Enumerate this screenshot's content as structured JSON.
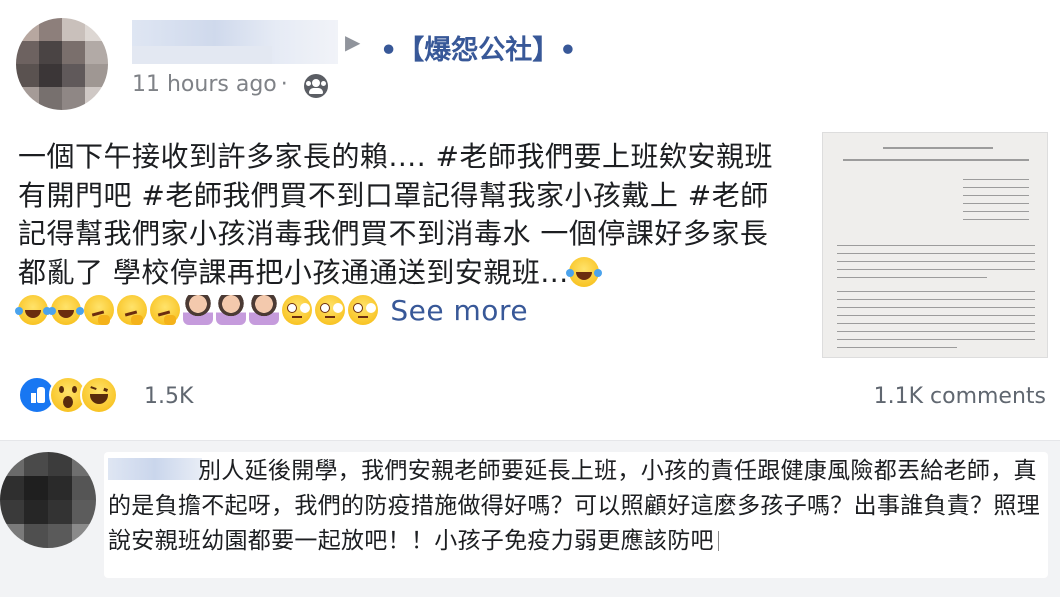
{
  "post": {
    "group_name": "•【爆怨公社】•",
    "time": "11 hours ago",
    "separator": "·",
    "text": "一個下午接收到許多家長的賴.... #老師我們要上班欸安親班有開門吧 #老師我們買不到口罩記得幫我家小孩戴上 #老師記得幫我們家小孩消毒我們買不到消毒水 一個停課好多家長都亂了 學校停課再把小孩通通送到安親班...",
    "see_more": "See more",
    "emojis": [
      "laugh-cry",
      "laugh-cry",
      "laugh-cry",
      "thinking",
      "thinking",
      "thinking",
      "facepalm-woman",
      "facepalm-woman",
      "facepalm-woman",
      "eye-roll",
      "eye-roll",
      "eye-roll"
    ],
    "reaction_icons": [
      "like-icon",
      "wow-icon",
      "haha-icon"
    ],
    "reaction_count": "1.5K",
    "comments_count": "1.1K comments"
  },
  "comment": {
    "text": "別人延後開學，我們安親老師要延長上班，小孩的責任跟健康風險都丟給老師，真的是負擔不起呀，我們的防疫措施做得好嗎？可以照顧好這麼多孩子嗎？出事誰負責？照理說安親班幼園都要一起放吧！！小孩子免疫力弱更應該防吧"
  },
  "colors": {
    "link": "#385898",
    "meta": "#7f8287",
    "comment_bg": "#f2f3f5",
    "like": "#1877f2"
  }
}
